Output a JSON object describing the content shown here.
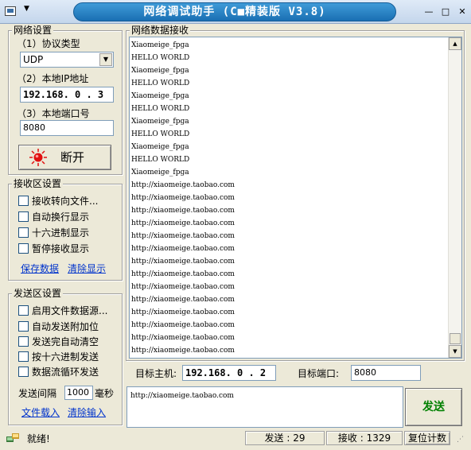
{
  "window": {
    "title": "网络调试助手 (C■精装版 V3.8)",
    "controls": {
      "minimize": "—",
      "maximize": "□",
      "close": "✕"
    }
  },
  "net_settings": {
    "title": "网络设置",
    "protocol_label": "（1）协议类型",
    "protocol_value": "UDP",
    "local_ip_label": "（2）本地IP地址",
    "local_ip_value": "192.168. 0 . 3",
    "local_port_label": "（3）本地端口号",
    "local_port_value": "8080",
    "connect_button": "断开"
  },
  "recv_settings": {
    "title": "接收区设置",
    "options": [
      "接收转向文件...",
      "自动换行显示",
      "十六进制显示",
      "暂停接收显示"
    ],
    "save_link": "保存数据",
    "clear_link": "清除显示"
  },
  "send_settings": {
    "title": "发送区设置",
    "options": [
      "启用文件数据源...",
      "自动发送附加位",
      "发送完自动清空",
      "按十六进制发送",
      "数据流循环发送"
    ],
    "interval_label": "发送间隔",
    "interval_value": "1000",
    "interval_unit": "毫秒",
    "load_link": "文件载入",
    "clear_link": "清除输入"
  },
  "recv_area": {
    "title": "网络数据接收",
    "lines": [
      "Xiaomeige_fpga",
      "HELLO WORLD",
      "Xiaomeige_fpga",
      "HELLO WORLD",
      "Xiaomeige_fpga",
      "HELLO WORLD",
      "Xiaomeige_fpga",
      "HELLO WORLD",
      "Xiaomeige_fpga",
      "HELLO WORLD",
      "Xiaomeige_fpga",
      "http://xiaomeige.taobao.com",
      "http://xiaomeige.taobao.com",
      "http://xiaomeige.taobao.com",
      "http://xiaomeige.taobao.com",
      "http://xiaomeige.taobao.com",
      "http://xiaomeige.taobao.com",
      "http://xiaomeige.taobao.com",
      "http://xiaomeige.taobao.com",
      "http://xiaomeige.taobao.com",
      "http://xiaomeige.taobao.com",
      "http://xiaomeige.taobao.com",
      "http://xiaomeige.taobao.com",
      "http://xiaomeige.taobao.com",
      "http://xiaomeige.taobao.com"
    ]
  },
  "target": {
    "host_label": "目标主机:",
    "host_value": "192.168. 0 . 2",
    "port_label": "目标端口:",
    "port_value": "8080"
  },
  "send_area": {
    "text": "http://xiaomeige.taobao.com",
    "send_button": "发送"
  },
  "status": {
    "ready": "就绪!",
    "sent": "发送 : 29",
    "received": "接收 : 1329",
    "reset": "复位计数"
  },
  "colors": {
    "title_pill": "#1a6fb3",
    "send_button_text": "#008000",
    "link": "#0033cc",
    "connect_led": "#e01010"
  }
}
